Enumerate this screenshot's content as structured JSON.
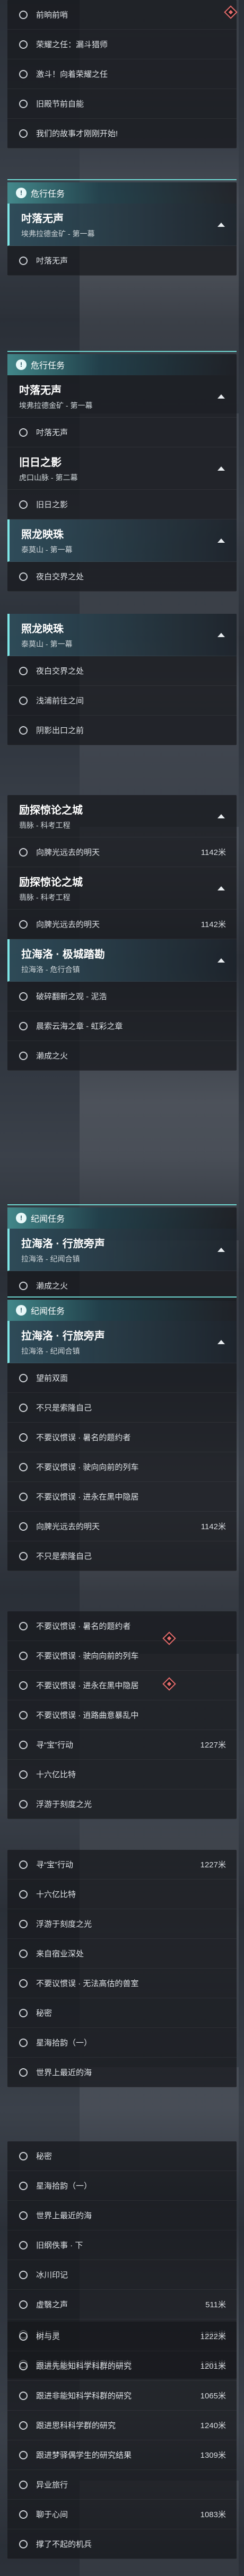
{
  "sections": [
    {
      "items": [
        "前晌前哨",
        "荣耀之任：漏斗猎师",
        "激斗！向着荣耀之任",
        "旧殿节前自能",
        "我们的故事才刚刚开始!"
      ]
    },
    {
      "category": "危行任务",
      "quest": {
        "title": "吋落无声",
        "sub": "埃弗拉德金矿 - 第一幕"
      },
      "items": [
        "吋落无声"
      ]
    },
    {
      "category": "危行任务",
      "quests": [
        {
          "title": "吋落无声",
          "sub": "埃弗拉德金矿 - 第一幕",
          "items": [
            "吋落无声"
          ]
        },
        {
          "title": "旧日之影",
          "sub": "虎口山脉 - 第二幕",
          "items": [
            "旧日之影"
          ]
        },
        {
          "title": "照龙映珠",
          "sub": "泰莫山 - 第一幕",
          "items": [
            "夜白交界之处"
          ]
        }
      ]
    },
    {
      "quest": {
        "title": "照龙映珠",
        "sub": "泰莫山 - 第一幕"
      },
      "items": [
        "夜白交界之处",
        "浅浦前往之间",
        "阴影出口之前"
      ]
    },
    {
      "quests": [
        {
          "title": "励探惊论之城",
          "sub": "翡脉 - 科考工程",
          "items": [
            {
              "t": "向脾光远去的明天",
              "d": "1142米"
            }
          ]
        },
        {
          "title": "励探惊论之城",
          "sub": "翡脉 - 科考工程",
          "items": [
            {
              "t": "向脾光远去的明天",
              "d": "1142米"
            }
          ]
        },
        {
          "title": "拉海洛 · 极城踏勘",
          "sub": "拉海洛 - 危行合镇",
          "items": [
            {
              "t": "破碎翻新之观 - 泥浩",
              "d": ""
            },
            {
              "t": "晨索云海之章 - 虹彩之章",
              "d": ""
            },
            {
              "t": "濑成之火",
              "d": ""
            }
          ]
        }
      ]
    },
    {
      "category": "纪闻任务",
      "quest": {
        "title": "拉海洛 · 行旅旁声",
        "sub": "拉海洛 - 纪闻合镇"
      },
      "items": [
        "濑成之火"
      ]
    },
    {
      "category": "纪闻任务",
      "quest": {
        "title": "拉海洛 · 行旅旁声",
        "sub": "拉海洛 - 纪闻合镇"
      },
      "items": [
        {
          "t": "望前双面",
          "d": ""
        },
        {
          "t": "不只是索隆自己",
          "d": ""
        },
        {
          "t": "不要议惯误 · 暑名的题约者",
          "d": ""
        },
        {
          "t": "不要议惯误 · 驶向向前的列车",
          "d": ""
        },
        {
          "t": "不要议惯误 · 进永在黑中隐居",
          "d": ""
        },
        {
          "t": "向脾光远去的明天",
          "d": "1142米"
        },
        {
          "t": "不只是索隆自己",
          "d": ""
        }
      ]
    },
    {
      "items": [
        {
          "t": "不要议惯误 · 暑名的题约者",
          "d": ""
        },
        {
          "t": "不要议惯误 · 驶向向前的列车",
          "d": ""
        },
        {
          "t": "不要议惯误 · 进永在黑中隐居",
          "d": ""
        },
        {
          "t": "不要议惯误 · 逍路曲意暴乱中",
          "d": ""
        },
        {
          "t": "寻“宝”行动",
          "d": "1227米"
        },
        {
          "t": "十六亿比特",
          "d": ""
        },
        {
          "t": "浮游于刻度之光",
          "d": ""
        }
      ]
    },
    {
      "items": [
        {
          "t": "寻“宝”行动",
          "d": "1227米"
        },
        {
          "t": "十六亿比特",
          "d": ""
        },
        {
          "t": "浮游于刻度之光",
          "d": ""
        },
        {
          "t": "来自宿业深处",
          "d": ""
        },
        {
          "t": "不要议惯误 · 无法高估的兽室",
          "d": ""
        },
        {
          "t": "秘密",
          "d": ""
        },
        {
          "t": "星海拾韵（一）",
          "d": ""
        },
        {
          "t": "世界上最近的海",
          "d": ""
        }
      ]
    },
    {
      "items": [
        {
          "t": "秘密",
          "d": ""
        },
        {
          "t": "星海拾韵（一）",
          "d": ""
        },
        {
          "t": "世界上最近的海",
          "d": ""
        },
        {
          "t": "旧纲佚事 · 下",
          "d": ""
        },
        {
          "t": "冰川印记",
          "d": ""
        },
        {
          "t": "虚翳之声",
          "d": "511米"
        },
        {
          "t": "树与灵",
          "d": "1222米"
        },
        {
          "t": "跟进先能知科学科群的研究",
          "d": "1201米"
        }
      ]
    },
    {
      "items": [
        {
          "t": "树与灵",
          "d": "1222米"
        },
        {
          "t": "跟进先能知科学科群的研究",
          "d": "1201米"
        },
        {
          "t": "跟进非能知科学科群的研究",
          "d": "1065米"
        },
        {
          "t": "跟进思科科学群的研究",
          "d": "1240米"
        },
        {
          "t": "跟进梦驿偶学生的研究结果",
          "d": "1309米"
        },
        {
          "t": "异业旅行",
          "d": ""
        },
        {
          "t": "聊于心间",
          "d": "1083米"
        },
        {
          "t": "撑了不起的机兵",
          "d": ""
        }
      ]
    }
  ]
}
